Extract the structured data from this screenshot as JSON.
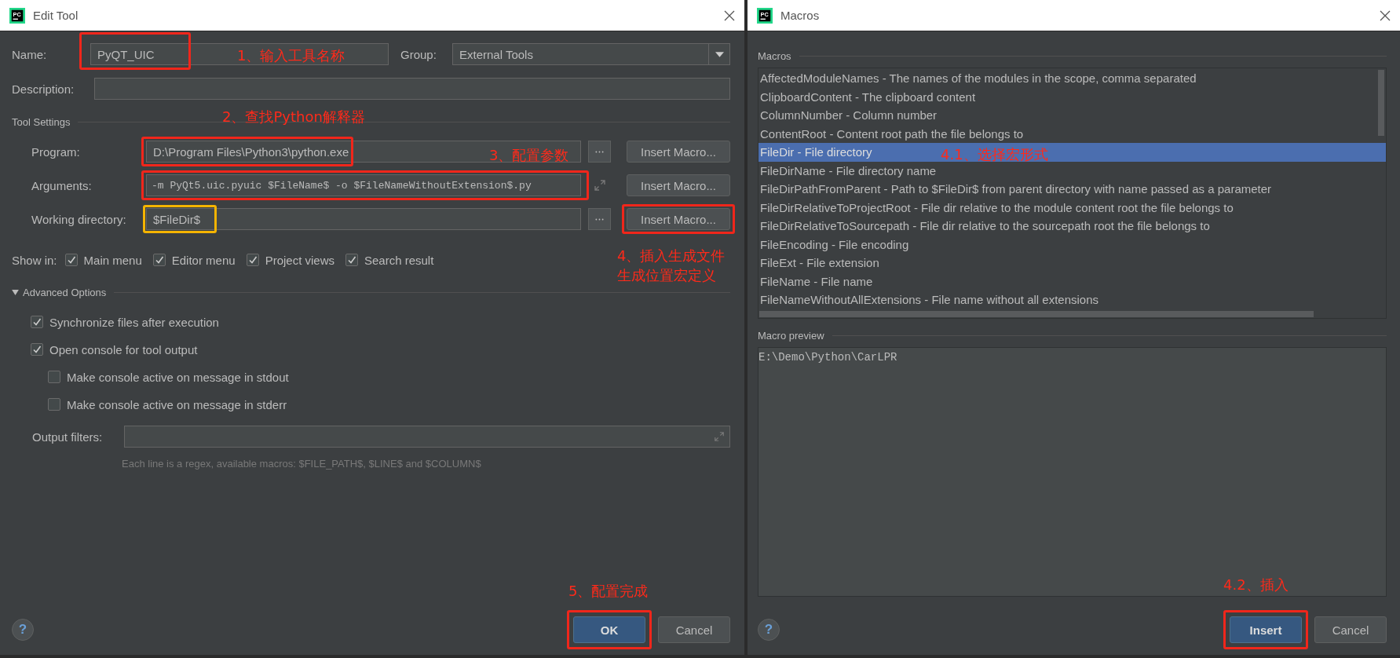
{
  "edit_tool": {
    "title": "Edit Tool",
    "logo": "PC",
    "name": {
      "label": "Name:",
      "value": "PyQT_UIC",
      "frame": {
        "color": "#f0261b"
      },
      "annotation": "1、输入工具名称"
    },
    "group": {
      "label": "Group:",
      "value": "External Tools"
    },
    "description": {
      "label": "Description:"
    },
    "tool_settings": {
      "title": "Tool Settings",
      "annotation": "2、查找Python解释器",
      "fields": [
        {
          "kind": "browse",
          "label": "Program:",
          "value": "D:\\Program Files\\Python3\\python.exe",
          "frame": {
            "color": "#f0261b"
          },
          "annotation": "3、配置参数",
          "macro_button": "Insert Macro..."
        },
        {
          "kind": "expand",
          "label": "Arguments:",
          "value": "-m PyQt5.uic.pyuic  $FileName$ -o $FileNameWithoutExtension$.py",
          "frame": {
            "color": "#f0261b"
          },
          "macro_button": "Insert Macro..."
        },
        {
          "kind": "browse",
          "label": "Working directory:",
          "value": "$FileDir$",
          "frame": {
            "color": "#f5b400"
          },
          "macro_button": "Insert Macro...",
          "macro_button_frame": {
            "color": "#f0261b"
          },
          "annotation_lines": [
            "4、插入生成文件",
            "生成位置宏定义"
          ]
        }
      ]
    },
    "show_in": {
      "label": "Show in:",
      "options": [
        {
          "label": "Main menu",
          "checked": true
        },
        {
          "label": "Editor menu",
          "checked": true
        },
        {
          "label": "Project views",
          "checked": true
        },
        {
          "label": "Search result",
          "checked": true
        }
      ]
    },
    "advanced": {
      "title": "Advanced Options",
      "expanded": true,
      "options": [
        {
          "label": "Synchronize files after execution",
          "checked": true
        },
        {
          "label": "Open console for tool output",
          "checked": true,
          "children": [
            {
              "label": "Make console active on message in stdout",
              "checked": false
            },
            {
              "label": "Make console active on message in stderr",
              "checked": false
            }
          ]
        }
      ]
    },
    "output_filters": {
      "label": "Output filters:",
      "hint": "Each line is a regex, available macros: $FILE_PATH$, $LINE$ and $COLUMN$"
    },
    "buttons": [
      {
        "kind": "primary",
        "label": "OK",
        "frame": {
          "color": "#f0261b"
        },
        "annotation": "5、配置完成"
      },
      {
        "kind": "secondary",
        "label": "Cancel"
      }
    ],
    "help": "?"
  },
  "macros": {
    "title": "Macros",
    "logo": "PC",
    "list_title": "Macros",
    "selected_annotation": "4.1、选择宏形式",
    "items": [
      {
        "label": "AffectedModuleNames - The names of the modules in the scope, comma separated",
        "selected": false
      },
      {
        "label": "ClipboardContent - The clipboard content",
        "selected": false
      },
      {
        "label": "ColumnNumber - Column number",
        "selected": false
      },
      {
        "label": "ContentRoot - Content root path the file belongs to",
        "selected": false
      },
      {
        "label": "FileDir - File directory",
        "selected": true
      },
      {
        "label": "FileDirName - File directory name",
        "selected": false
      },
      {
        "label": "FileDirPathFromParent - Path to $FileDir$ from parent directory with name passed as a parameter",
        "selected": false
      },
      {
        "label": "FileDirRelativeToProjectRoot - File dir relative to the module content root the file belongs to",
        "selected": false
      },
      {
        "label": "FileDirRelativeToSourcepath - File dir relative to the sourcepath root the file belongs to",
        "selected": false
      },
      {
        "label": "FileEncoding - File encoding",
        "selected": false
      },
      {
        "label": "FileExt - File extension",
        "selected": false
      },
      {
        "label": "FileName - File name",
        "selected": false
      },
      {
        "label": "FileNameWithoutAllExtensions - File name without all extensions",
        "selected": false
      }
    ],
    "preview_title": "Macro preview",
    "preview": "E:\\Demo\\Python\\CarLPR",
    "buttons": [
      {
        "kind": "primary",
        "label": "Insert",
        "frame": {
          "color": "#f0261b"
        },
        "annotation": "4.2、插入"
      },
      {
        "kind": "secondary",
        "label": "Cancel"
      }
    ],
    "help": "?"
  }
}
